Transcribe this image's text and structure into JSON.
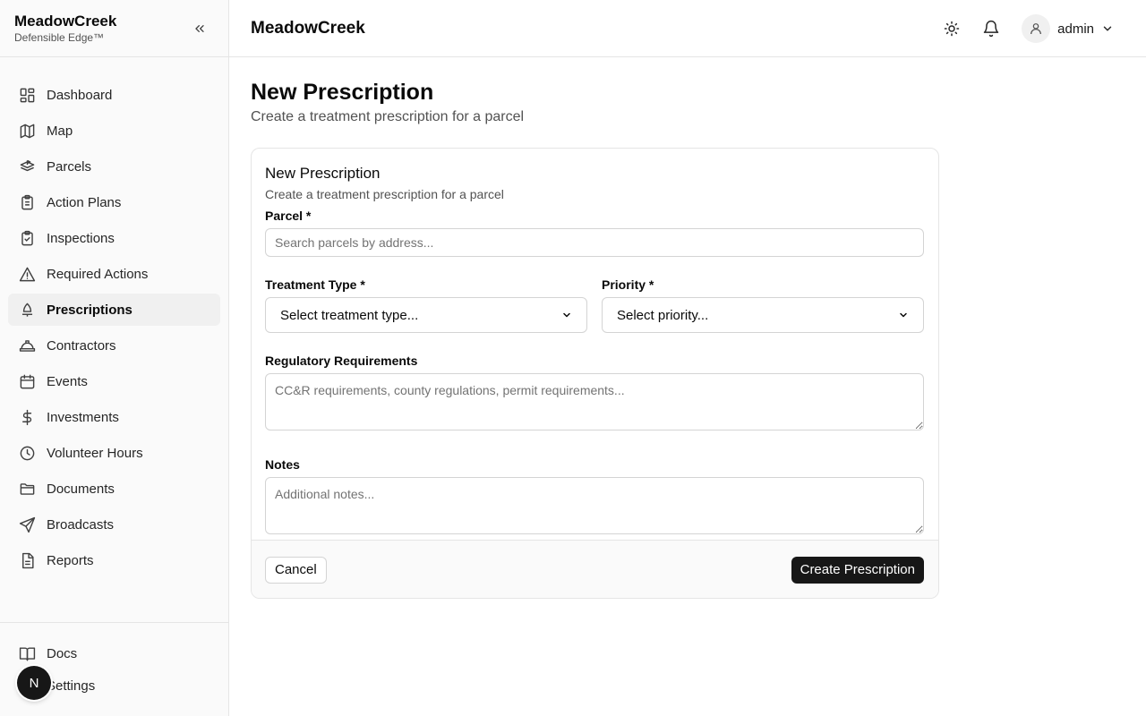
{
  "brand": {
    "name": "MeadowCreek",
    "subtitle": "Defensible Edge™"
  },
  "sidebar": {
    "items": [
      {
        "label": "Dashboard",
        "icon": "dashboard-icon"
      },
      {
        "label": "Map",
        "icon": "map-icon"
      },
      {
        "label": "Parcels",
        "icon": "parcels-icon"
      },
      {
        "label": "Action Plans",
        "icon": "clipboard-icon"
      },
      {
        "label": "Inspections",
        "icon": "clipboard-check-icon"
      },
      {
        "label": "Required Actions",
        "icon": "warning-icon"
      },
      {
        "label": "Prescriptions",
        "icon": "tree-icon",
        "active": true
      },
      {
        "label": "Contractors",
        "icon": "hard-hat-icon"
      },
      {
        "label": "Events",
        "icon": "calendar-icon"
      },
      {
        "label": "Investments",
        "icon": "dollar-icon"
      },
      {
        "label": "Volunteer Hours",
        "icon": "clock-icon"
      },
      {
        "label": "Documents",
        "icon": "folder-icon"
      },
      {
        "label": "Broadcasts",
        "icon": "send-icon"
      },
      {
        "label": "Reports",
        "icon": "file-text-icon"
      }
    ],
    "bottom_items": [
      {
        "label": "Docs",
        "icon": "book-icon"
      },
      {
        "label": "Settings",
        "icon": "gear-icon"
      }
    ],
    "fab_letter": "N"
  },
  "header": {
    "title": "MeadowCreek",
    "user": "admin"
  },
  "page": {
    "title": "New Prescription",
    "subtitle": "Create a treatment prescription for a parcel"
  },
  "form": {
    "title": "New Prescription",
    "subtitle": "Create a treatment prescription for a parcel",
    "parcel": {
      "label": "Parcel *",
      "placeholder": "Search parcels by address..."
    },
    "treatment_type": {
      "label": "Treatment Type *",
      "selected": "Select treatment type..."
    },
    "priority": {
      "label": "Priority *",
      "selected": "Select priority..."
    },
    "regulatory": {
      "label": "Regulatory Requirements",
      "placeholder": "CC&R requirements, county regulations, permit requirements..."
    },
    "notes": {
      "label": "Notes",
      "placeholder": "Additional notes..."
    },
    "cancel_label": "Cancel",
    "submit_label": "Create Prescription"
  }
}
